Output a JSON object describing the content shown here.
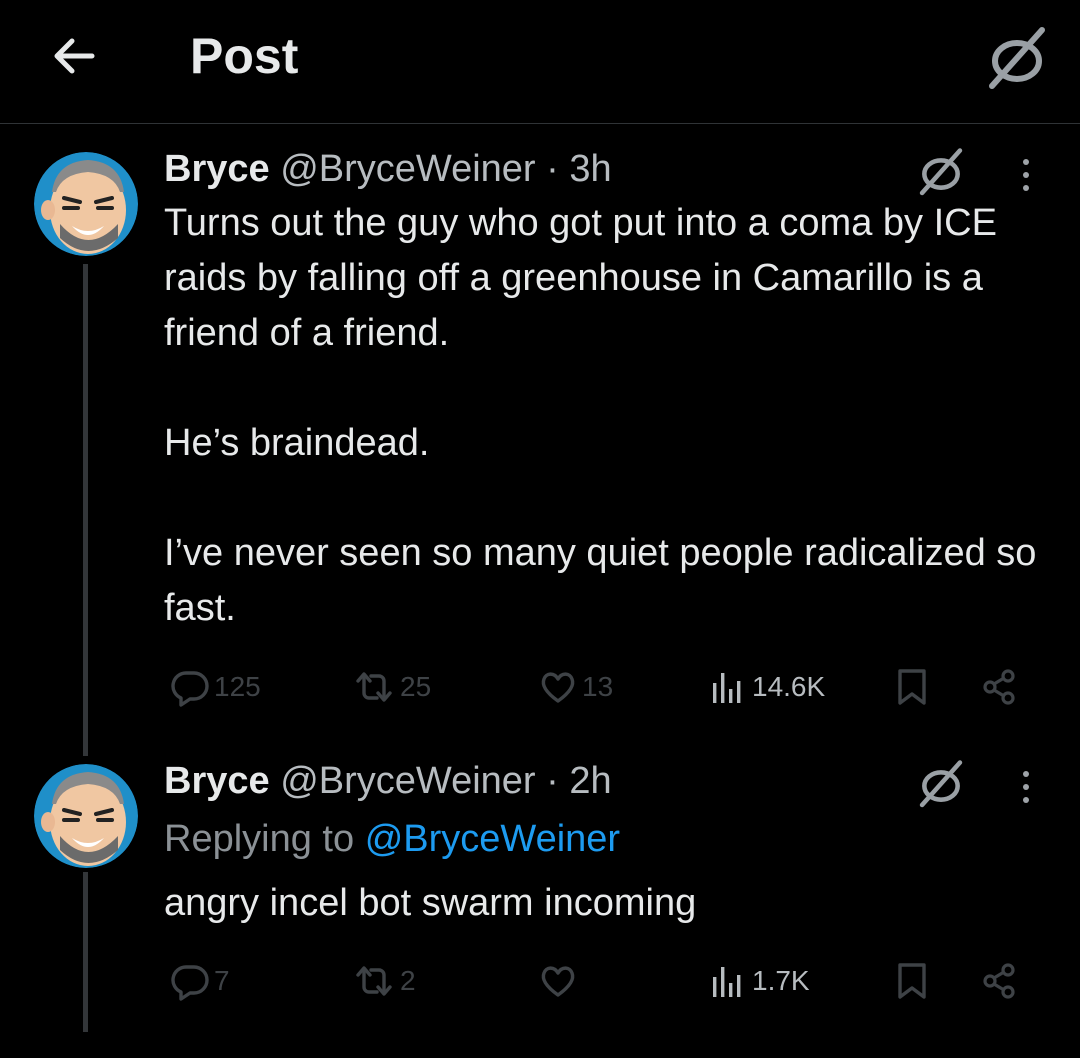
{
  "header": {
    "title": "Post",
    "back_icon": "arrow-left-icon",
    "logo_icon": "slashed-circle-logo-icon"
  },
  "posts": [
    {
      "author_name": "Bryce",
      "author_handle": "@BryceWeiner",
      "time": "· 3h",
      "paragraphs": [
        "Turns out the guy who got put into a coma by ICE raids by falling off a greenhouse in Camarillo is a friend of a friend.",
        "He’s braindead.",
        "I’ve never seen so many quiet people radicalized so fast."
      ],
      "counts": {
        "replies": "125",
        "reposts": "25",
        "likes": "13",
        "views": "14.6K"
      }
    },
    {
      "author_name": "Bryce",
      "author_handle": "@BryceWeiner",
      "time": "· 2h",
      "reply_prefix": "Replying to",
      "reply_mention": "@BryceWeiner",
      "text": "angry incel bot swarm incoming",
      "counts": {
        "replies": "7",
        "reposts": "2",
        "likes": "",
        "views": "1.7K"
      }
    }
  ],
  "colors": {
    "background": "#000000",
    "text": "#e7e9ea",
    "secondary": "#b7bcc0",
    "mention": "#1d9bf0",
    "muted_icon": "#3e4246"
  }
}
